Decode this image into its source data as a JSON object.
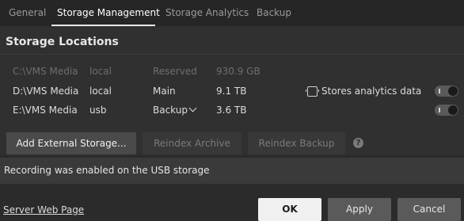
{
  "tabs": [
    {
      "label": "General",
      "active": false
    },
    {
      "label": "Storage Management",
      "active": true
    },
    {
      "label": "Storage Analytics",
      "active": false
    },
    {
      "label": "Backup",
      "active": false
    }
  ],
  "section": {
    "title": "Storage Locations"
  },
  "storages": [
    {
      "path": "C:\\VMS Media",
      "type": "local",
      "role": "Reserved",
      "size": "930.9 GB",
      "disabled": true
    },
    {
      "path": "D:\\VMS Media",
      "type": "local",
      "role": "Main",
      "size": "9.1 TB",
      "disabled": false,
      "analytics_label": "Stores analytics data",
      "enabled": true
    },
    {
      "path": "E:\\VMS Media",
      "type": "usb",
      "role": "Backup",
      "size": "3.6 TB",
      "disabled": false,
      "enabled": true
    }
  ],
  "buttons": {
    "add_external": "Add External Storage...",
    "reindex_archive": "Reindex Archive",
    "reindex_backup": "Reindex Backup",
    "help": "?"
  },
  "notice": "Recording was enabled on the USB storage",
  "footer": {
    "link": "Server Web Page",
    "ok": "OK",
    "apply": "Apply",
    "cancel": "Cancel"
  },
  "colors": {
    "background": "#2b2b2b",
    "panel": "#303030",
    "notice": "#3a3a3a",
    "ok_button": "#f0f0f0"
  }
}
